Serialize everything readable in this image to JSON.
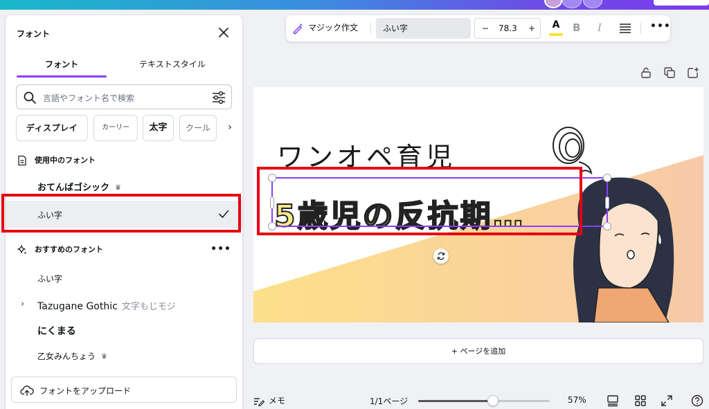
{
  "panel": {
    "title": "フォント",
    "tabs": [
      "フォント",
      "テキストスタイル"
    ],
    "search_placeholder": "言語やフォント名で検索",
    "chips": [
      "ディスプレイ",
      "カーリー",
      "太字",
      "クール",
      "›"
    ],
    "in_use_heading": "使用中のフォント",
    "in_use": [
      {
        "name": "おてんばゴシック",
        "premium": true
      },
      {
        "name": "ふい字",
        "selected": true
      }
    ],
    "recommended_heading": "おすすめのフォント",
    "recommended_more": "•••",
    "recommended": [
      {
        "name": "ふい字"
      },
      {
        "name": "Tazugane Gothic",
        "sample": "文字もじモジ"
      },
      {
        "name": "にくまる"
      },
      {
        "name": "乙女みんちょう",
        "premium": true
      }
    ],
    "crown_glyph": "♛",
    "upload_label": "フォントをアップロード"
  },
  "toolbar": {
    "magic_label": "マジック作文",
    "font_name": "ふい字",
    "minus": "−",
    "font_size": "78.3",
    "plus": "+",
    "color_glyph": "A",
    "text_color": "#f7e43b",
    "bold_glyph": "B",
    "italic_glyph": "I",
    "more_glyph": "•••"
  },
  "canvas": {
    "title": "ワンオペ育児",
    "selected_text": "5歳児の反抗期…"
  },
  "add_page_label": "+ ページを追加",
  "bottom": {
    "memo_label": "メモ",
    "page_indicator": "1/1ページ",
    "zoom_fraction": 0.57,
    "zoom_label": "57%"
  },
  "colors": {
    "accent": "#8b3dff",
    "highlight_red": "#e60012",
    "bg_gradient_start": "#fde08a",
    "bg_gradient_end": "#f7c9a8",
    "hair": "#2c3244",
    "shirt": "#f0a773"
  }
}
